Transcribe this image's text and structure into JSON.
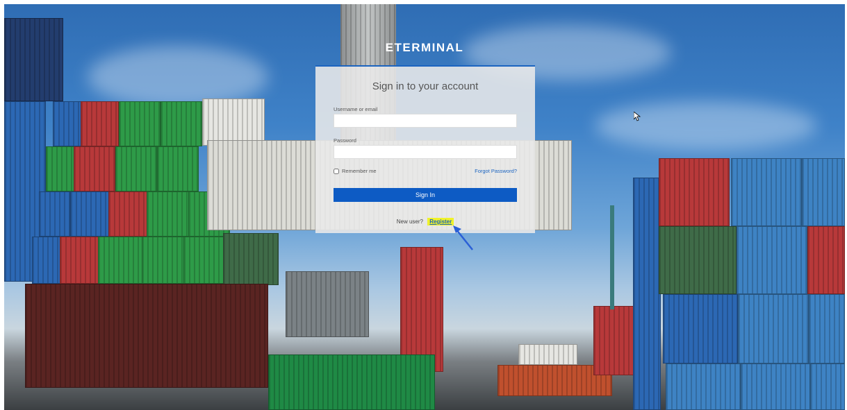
{
  "app": {
    "title": "ETERMINAL"
  },
  "login": {
    "heading": "Sign in to your account",
    "username_label": "Username or email",
    "username_value": "",
    "password_label": "Password",
    "password_value": "",
    "remember_label": "Remember me",
    "forgot_label": "Forgot Password?",
    "signin_label": "Sign In",
    "new_user_text": "New user?",
    "register_label": "Register"
  },
  "colors": {
    "accent": "#0d5bc4",
    "highlight": "#f0f22a",
    "title_text": "#ffffff"
  },
  "icons": {
    "cursor": "mouse-pointer-icon",
    "annotation": "arrow-icon"
  }
}
